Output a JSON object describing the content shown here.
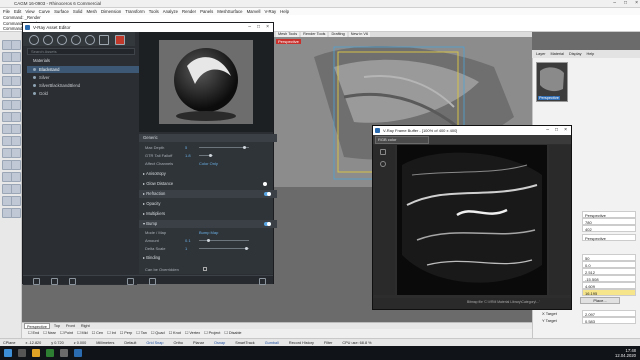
{
  "main_window": {
    "title": "CAGM 16-0903 - Rhinoceros 6 Commercial",
    "menu": [
      "File",
      "Edit",
      "View",
      "Curve",
      "Surface",
      "Solid",
      "Mesh",
      "Dimension",
      "Transform",
      "Tools",
      "Analyze",
      "Render",
      "Panels",
      "MeshSurface",
      "Marvell",
      "V-Ray",
      "Help"
    ],
    "command_lines": [
      "Command: _Render",
      "Command: _Render",
      "Command:"
    ]
  },
  "viewport": {
    "tabs": [
      "Standard",
      "CPlanes",
      "Set View",
      "Display",
      "Select",
      "Viewport Layout",
      "Visibility",
      "Transform",
      "Curve Tools",
      "Surface Tools",
      "Solid Tools",
      "Mesh Tools",
      "Render Tools",
      "Drafting",
      "New in V6"
    ],
    "label": "Perspective",
    "view_tabs": [
      "Perspective",
      "Top",
      "Front",
      "Right"
    ]
  },
  "vray_editor": {
    "title": "V-Ray Asset Editor",
    "search_placeholder": "Search Assets",
    "materials_header": "Materials",
    "materials": [
      "Blackstand",
      "Silver",
      "SilverBlackSandBlend",
      "Gold"
    ],
    "selected_material": "Blackstand",
    "section_generic": "Generic",
    "props": [
      {
        "k": "Max Depth",
        "v": "5"
      },
      {
        "k": "GTR Tail Falloff",
        "v": "1.8"
      },
      {
        "k": "Affect Channels",
        "v": "Color Only"
      }
    ],
    "sections": [
      "Anisotropy",
      "Glow Distance",
      "Refraction",
      "Opacity",
      "Multipliers",
      "Bump",
      "Binding"
    ],
    "bump": [
      {
        "k": "Mode / Map",
        "v": "Bump Map"
      },
      {
        "k": "Amount",
        "v": "0.1"
      },
      {
        "k": "Delta Scale",
        "v": "1"
      }
    ],
    "can_override": "Can be Overridden"
  },
  "vfb": {
    "title": "V-Ray Frame Buffer - [100% of 400 x 400]",
    "channel": "RGB color",
    "status": "Bitmap file 'C:\\VRM Material Library\\Category\\...'"
  },
  "right_panel": {
    "tabs": [
      "Layer",
      "Material",
      "Display",
      "Help"
    ],
    "thumb_label": "Perspective",
    "rows": [
      {
        "k": "Title",
        "v": "Perspective"
      },
      {
        "k": "Width",
        "v": "780"
      },
      {
        "k": "Height",
        "v": "402"
      },
      {
        "k": "Projection",
        "v": "Perspective"
      },
      {
        "k": "Lens Length",
        "v": "50"
      },
      {
        "k": "Rotation",
        "v": "0.0"
      },
      {
        "k": "X Location",
        "v": "2.512"
      },
      {
        "k": "Y Location",
        "v": "-15.508"
      },
      {
        "k": "Z Location",
        "v": "4.609"
      },
      {
        "k": "Distance",
        "v": "16.195"
      },
      {
        "k": "X Target",
        "v": "2.097"
      },
      {
        "k": "Y Target",
        "v": "0.583"
      }
    ],
    "place_button": "Place..."
  },
  "snapbar": [
    "End",
    "Near",
    "Point",
    "Mid",
    "Cen",
    "Int",
    "Perp",
    "Tan",
    "Quad",
    "Knot",
    "Vertex",
    "Project",
    "Disable"
  ],
  "statusbar": [
    "CPlane",
    "x -12.820",
    "y 0.720",
    "z 0.000",
    "Millimeters",
    "Default",
    "Grid Snap",
    "Ortho",
    "Planar",
    "Osnap",
    "SmartTrack",
    "Gumball",
    "Record History",
    "Filter",
    "CPU use: 68.8 %"
  ],
  "clock": {
    "time": "17:48",
    "date": "12.04.2020"
  }
}
